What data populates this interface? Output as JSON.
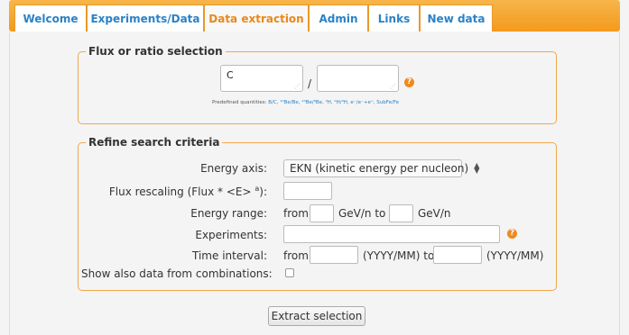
{
  "tabs": [
    {
      "label": "Welcome"
    },
    {
      "label": "Experiments/Data"
    },
    {
      "label": "Data extraction"
    },
    {
      "label": "Admin"
    },
    {
      "label": "Links"
    },
    {
      "label": "New data"
    }
  ],
  "flux": {
    "legend": "Flux or ratio selection",
    "numerator_value": "C",
    "denominator_value": "",
    "divider": "/",
    "help_icon": "question-icon",
    "predefined_label": "Predefined quantities:",
    "predefined_items": "B/C, ¹⁰Be/Be, ¹⁰Be/⁹Be, ²H, ²H/⁴H, e⁻/e⁻+e⁺, SubFe/Fe"
  },
  "refine": {
    "legend": "Refine search criteria",
    "energy_axis_label": "Energy axis:",
    "energy_axis_value": "EKN (kinetic energy per nucleon)",
    "flux_rescaling_label": "Flux rescaling (Flux * <E>",
    "flux_rescaling_sup": "a",
    "flux_rescaling_end": "):",
    "energy_range_label": "Energy range:",
    "from_label": "from",
    "gev_to_label": "GeV/n to",
    "gev_label": "GeV/n",
    "experiments_label": "Experiments:",
    "time_interval_label": "Time interval:",
    "time_from_label": "from",
    "yyyymm_to_label": "(YYYY/MM) to",
    "yyyymm_label": "(YYYY/MM)",
    "combinations_label": "Show also data from combinations:"
  },
  "extract_button": "Extract selection",
  "colors": {
    "accent": "#f39a1c",
    "tab_text": "#2a82c7",
    "active_tab_text": "#e6891b"
  }
}
